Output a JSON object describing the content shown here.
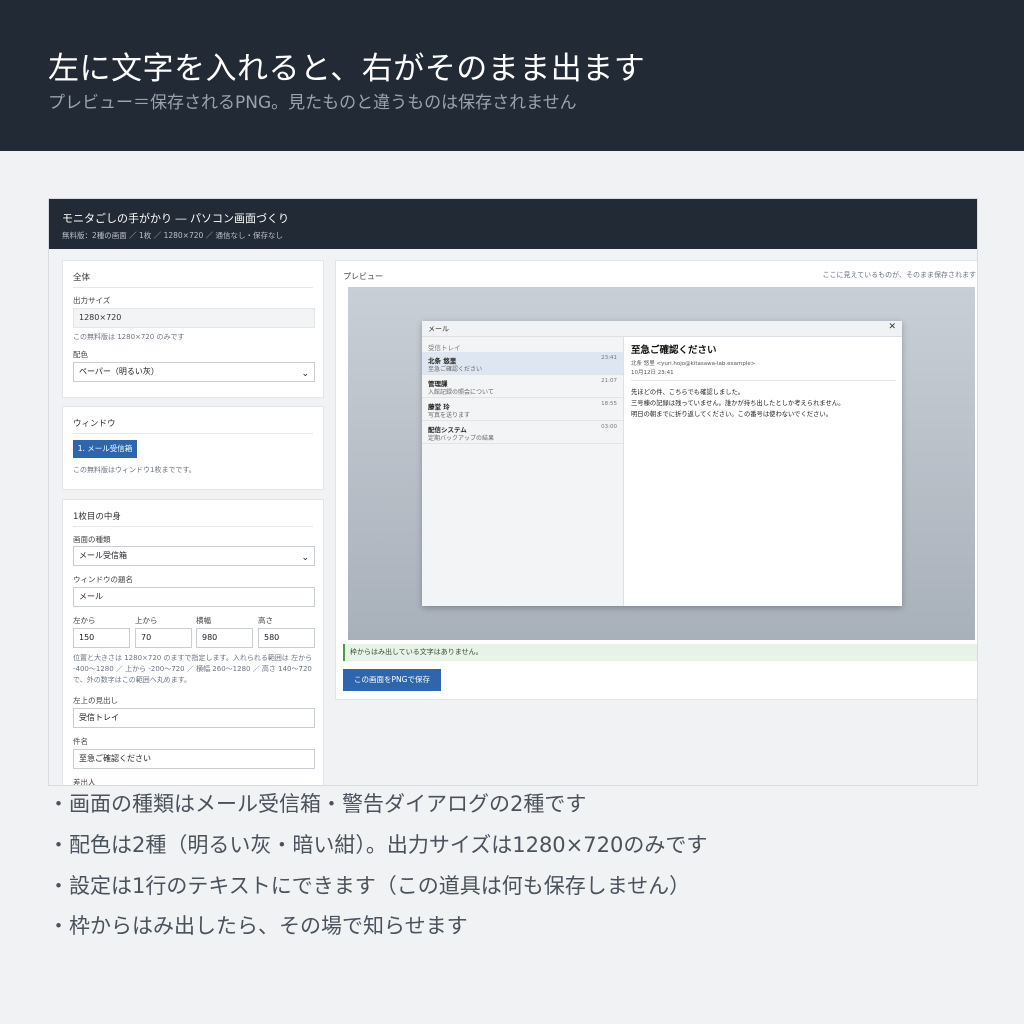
{
  "header": {
    "title": "左に文字を入れると、右がそのまま出ます",
    "subtitle": "プレビュー＝保存されるPNG。見たものと違うものは保存されません"
  },
  "app": {
    "title": "モニタごしの手がかり ― パソコン画面づくり",
    "subtitle": "無料版：2種の画面 ／ 1枚 ／ 1280×720 ／ 通信なし・保存なし",
    "overall": {
      "title": "全体",
      "size_label": "出力サイズ",
      "size_value": "1280×720",
      "size_note": "この無料版は 1280×720 のみです",
      "color_label": "配色",
      "color_value": "ペーパー（明るい灰）"
    },
    "window": {
      "title": "ウィンドウ",
      "button": "1. メール受信箱",
      "note": "この無料版はウィンドウ1枚までです。"
    },
    "content": {
      "title": "1枚目の中身",
      "type_label": "画面の種類",
      "type_value": "メール受信箱",
      "wtitle_label": "ウィンドウの題名",
      "wtitle_value": "メール",
      "pos_labels": [
        "左から",
        "上から",
        "横幅",
        "高さ"
      ],
      "pos_values": [
        "150",
        "70",
        "980",
        "580"
      ],
      "pos_note": "位置と大きさは 1280×720 のますで指定します。入れられる範囲は 左から -400〜1280 ／ 上から -200〜720 ／ 横幅 260〜1280 ／ 高さ 140〜720 で、外の数字はこの範囲へ丸めます。",
      "heading_label": "左上の見出し",
      "heading_value": "受信トレイ",
      "subject_label": "件名",
      "subject_value": "至急ご確認ください",
      "sender_label": "差出人"
    },
    "preview": {
      "title": "プレビュー",
      "hint": "ここに見えているものが、そのまま保存されます",
      "status": "枠からはみ出している文字はありません。",
      "save_button": "この画面をPNGで保存"
    },
    "mail": {
      "window_title": "メール",
      "close_icon": "✕",
      "inbox": "受信トレイ",
      "rows": [
        {
          "from": "北条 悠里",
          "time": "23:41",
          "subject": "至急ご確認ください"
        },
        {
          "from": "管理課",
          "time": "21:07",
          "subject": "入館記録の照会について"
        },
        {
          "from": "藤堂 玲",
          "time": "18:55",
          "subject": "写真を送ります"
        },
        {
          "from": "配信システム",
          "time": "03:00",
          "subject": "定期バックアップの結果"
        }
      ],
      "read": {
        "subject": "至急ご確認ください",
        "from": "北条 悠里 <yuri.hojo@kitasawa-lab.example>",
        "date": "10月12日 23:41",
        "lines": [
          "先ほどの件、こちらでも確認しました。",
          "三号棟の記録は残っていません。誰かが持ち出したとしか考えられません。",
          "明日の朝までに折り返してください。この番号は使わないでください。"
        ]
      }
    }
  },
  "bullets": [
    "・画面の種類はメール受信箱・警告ダイアログの2種です",
    "・配色は2種（明るい灰・暗い紺）。出力サイズは1280×720のみです",
    "・設定は1行のテキストにできます（この道具は何も保存しません）",
    "・枠からはみ出したら、その場で知らせます"
  ]
}
